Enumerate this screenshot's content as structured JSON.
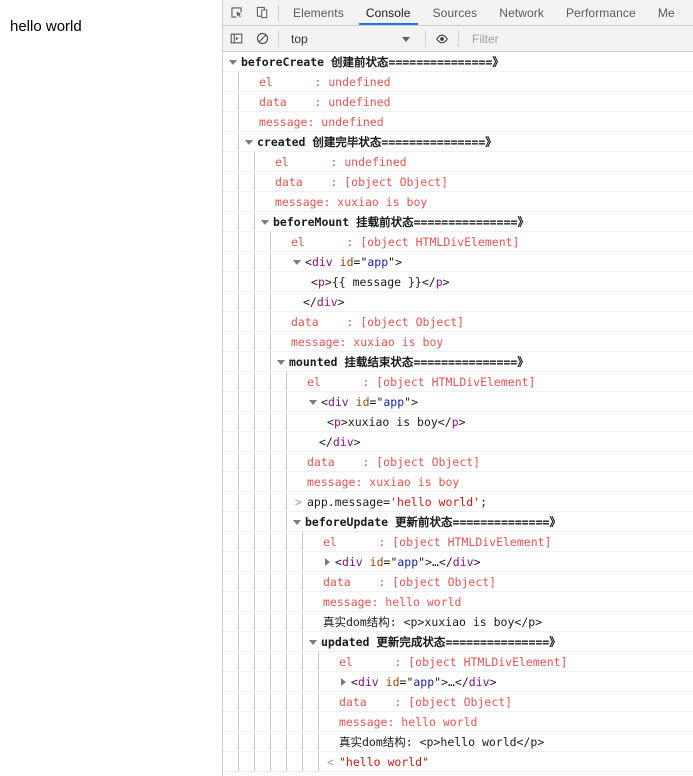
{
  "page": {
    "body_text": "hello world"
  },
  "devtools": {
    "tabbar": {
      "inspect_icon": "inspect-element-icon",
      "device_icon": "device-toolbar-icon",
      "tabs": [
        {
          "label": "Elements",
          "active": false
        },
        {
          "label": "Console",
          "active": true
        },
        {
          "label": "Sources",
          "active": false
        },
        {
          "label": "Network",
          "active": false
        },
        {
          "label": "Performance",
          "active": false
        },
        {
          "label": "Me",
          "active": false
        }
      ]
    },
    "console_toolbar": {
      "sidebar_icon": "console-sidebar-icon",
      "clear_icon": "clear-console-icon",
      "context": "top",
      "eye_icon": "live-expression-eye-icon",
      "filter_placeholder": "Filter"
    },
    "log": [
      {
        "type": "group",
        "indent": 0,
        "color": "black",
        "text": "beforeCreate 创建前状态===============》"
      },
      {
        "type": "text",
        "indent": 1,
        "color": "red",
        "text": "el      : undefined"
      },
      {
        "type": "text",
        "indent": 1,
        "color": "red",
        "text": "data    : undefined"
      },
      {
        "type": "text",
        "indent": 1,
        "color": "red",
        "text": "message: undefined"
      },
      {
        "type": "group",
        "indent": 1,
        "color": "black",
        "text": "created 创建完毕状态===============》"
      },
      {
        "type": "text",
        "indent": 2,
        "color": "red",
        "text": "el      : undefined"
      },
      {
        "type": "text",
        "indent": 2,
        "color": "red",
        "text": "data    : [object Object]"
      },
      {
        "type": "text",
        "indent": 2,
        "color": "red",
        "text": "message: xuxiao is boy"
      },
      {
        "type": "group",
        "indent": 2,
        "color": "black",
        "text": "beforeMount 挂载前状态===============》"
      },
      {
        "type": "text",
        "indent": 3,
        "color": "red",
        "text": "el      : [object HTMLDivElement]"
      },
      {
        "type": "dom-open",
        "indent": 3,
        "tag": "div",
        "attr": "id",
        "value": "app"
      },
      {
        "type": "dom-child",
        "indent": 3,
        "tag": "p",
        "inner": "{{ message }}"
      },
      {
        "type": "dom-close",
        "indent": 3,
        "tag": "div"
      },
      {
        "type": "text",
        "indent": 3,
        "color": "red",
        "text": "data    : [object Object]"
      },
      {
        "type": "text",
        "indent": 3,
        "color": "red",
        "text": "message: xuxiao is boy"
      },
      {
        "type": "group",
        "indent": 3,
        "color": "black",
        "text": "mounted 挂载结束状态===============》"
      },
      {
        "type": "text",
        "indent": 4,
        "color": "red",
        "text": "el      : [object HTMLDivElement]"
      },
      {
        "type": "dom-open",
        "indent": 4,
        "tag": "div",
        "attr": "id",
        "value": "app"
      },
      {
        "type": "dom-child",
        "indent": 4,
        "tag": "p",
        "inner": "xuxiao is boy"
      },
      {
        "type": "dom-close",
        "indent": 4,
        "tag": "div"
      },
      {
        "type": "text",
        "indent": 4,
        "color": "red",
        "text": "data    : [object Object]"
      },
      {
        "type": "text",
        "indent": 4,
        "color": "red",
        "text": "message: xuxiao is boy"
      },
      {
        "type": "input",
        "indent": 4,
        "code": "app.message=",
        "string": "'hello world'",
        "tail": ";"
      },
      {
        "type": "group",
        "indent": 4,
        "color": "black",
        "text": "beforeUpdate 更新前状态==============》"
      },
      {
        "type": "text",
        "indent": 5,
        "color": "red",
        "text": "el      : [object HTMLDivElement]"
      },
      {
        "type": "dom-collapsed",
        "indent": 5,
        "tag": "div",
        "attr": "id",
        "value": "app"
      },
      {
        "type": "text",
        "indent": 5,
        "color": "red",
        "text": "data    : [object Object]"
      },
      {
        "type": "text",
        "indent": 5,
        "color": "red",
        "text": "message: hello world"
      },
      {
        "type": "plain",
        "indent": 5,
        "cjk": "真实dom结构: ",
        "text": "<p>xuxiao is boy</p>"
      },
      {
        "type": "group",
        "indent": 5,
        "color": "black",
        "text": "updated 更新完成状态===============》"
      },
      {
        "type": "text",
        "indent": 6,
        "color": "red",
        "text": "el      : [object HTMLDivElement]"
      },
      {
        "type": "dom-collapsed",
        "indent": 6,
        "tag": "div",
        "attr": "id",
        "value": "app"
      },
      {
        "type": "text",
        "indent": 6,
        "color": "red",
        "text": "data    : [object Object]"
      },
      {
        "type": "text",
        "indent": 6,
        "color": "red",
        "text": "message: hello world"
      },
      {
        "type": "plain",
        "indent": 6,
        "cjk": "真实dom结构: ",
        "text": "<p>hello world</p>"
      },
      {
        "type": "output",
        "indent": 6,
        "text": "\"hello world\""
      }
    ]
  },
  "colors": {
    "accent": "#1a73e8",
    "error_red": "#e45454",
    "string_red": "#c41a16",
    "dom_tag": "#881280",
    "dom_attr": "#994500",
    "dom_value": "#1a1aa6",
    "toolbar_bg": "#f3f3f3",
    "border": "#cdcdcd"
  }
}
